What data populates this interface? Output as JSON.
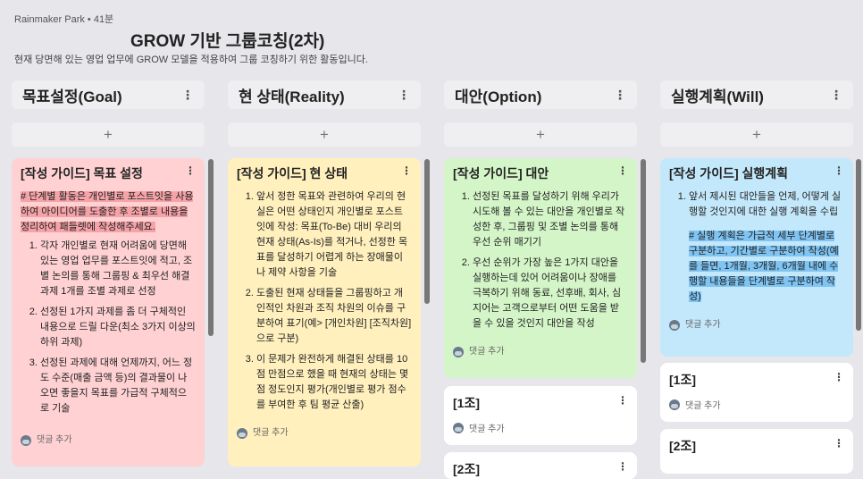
{
  "header": {
    "meta": "Rainmaker Park • 41분",
    "title": "GROW 기반 그룹코칭(2차)",
    "description": "현재 당면해 있는 영업 업무에 GROW 모델을 적용하여 그룹 코칭하기 위한 활동입니다."
  },
  "common": {
    "add": "+",
    "kebab": "⋮",
    "comment": "댓글 추가"
  },
  "columns": [
    {
      "title": "목표설정(Goal)",
      "card": {
        "title": "[작성 가이드] 목표 설정",
        "highlight": "# 단계별 활동은 개인별로 포스트잇을 사용하여 아이디어를 도출한 후 조별로 내용을 정리하여 패들렛에 작성해주세요.",
        "items": [
          "각자 개인별로 현재 어려움에 당면해 있는 영업 업무를 포스트잇에 적고, 조별 논의를 통해 그룹핑 & 최우선 해결 과제 1개를 조별 과제로 선정",
          "선정된 1가지 과제를 좀 더 구체적인 내용으로 드릴 다운(최소 3가지 이상의 하위 과제)",
          "선정된 과제에 대해 언제까지, 어느 정도 수준(매출 금액 등)의 결과물이 나오면 좋을지 목표를 가급적 구체적으로 기술"
        ],
        "color": "#ffd1d3"
      }
    },
    {
      "title": "현 상태(Reality)",
      "card": {
        "title": "[작성 가이드] 현 상태",
        "items": [
          "앞서 정한 목표와 관련하여 우리의 현실은 어떤 상태인지 개인별로 포스트잇에 작성: 목표(To-Be) 대비 우리의 현재 상태(As-Is)를 적거나, 선정한 목표를 달성하기 어렵게 하는 장애물이나 제약 사항을 기술",
          "도출된 현재 상태들을 그룹핑하고 개인적인 차원과 조직 차원의 이슈를 구분하여 표기(예> [개인차원] [조직차원]으로 구분)",
          "이 문제가 완전하게 해결된 상태를 10점 만점으로 했을 때 현재의 상태는 몇 점 정도인지 평가(개인별로 평가 점수를 부여한 후 팀 평균 산출)"
        ],
        "color": "#fff0bd"
      }
    },
    {
      "title": "대안(Option)",
      "card": {
        "title": "[작성 가이드] 대안",
        "items": [
          "선정된 목표를 달성하기 위해 우리가 시도해 볼 수 있는 대안을 개인별로 작성한 후, 그룹핑 및 조별 논의를 통해 우선 순위 매기기",
          "우선 순위가 가장 높은 1가지 대안을 실행하는데 있어 어려움이나 장애를 극복하기 위해 동료, 선후배, 회사, 심지어는 고객으로부터 어떤 도움을 받을 수 있을 것인지 대안을 작성"
        ],
        "color": "#d4f5c8"
      },
      "extra_cards": [
        "[1조]",
        "[2조]"
      ]
    },
    {
      "title": "실행계획(Will)",
      "card": {
        "title": "[작성 가이드] 실행계획",
        "items": [
          "앞서 제시된 대안들을 언제, 어떻게 실행할 것인지에 대한 실행 계획을 수립"
        ],
        "highlight": "# 실행 계획은 가급적 세부 단계별로 구분하고, 기간별로 구분하여 작성(예를 들면, 1개월, 3개월, 6개월 내에 수행할 내용들을 단계별로 구분하여 작성)",
        "color": "#c3e8fb"
      },
      "extra_cards": [
        "[1조]",
        "[2조]"
      ]
    }
  ]
}
